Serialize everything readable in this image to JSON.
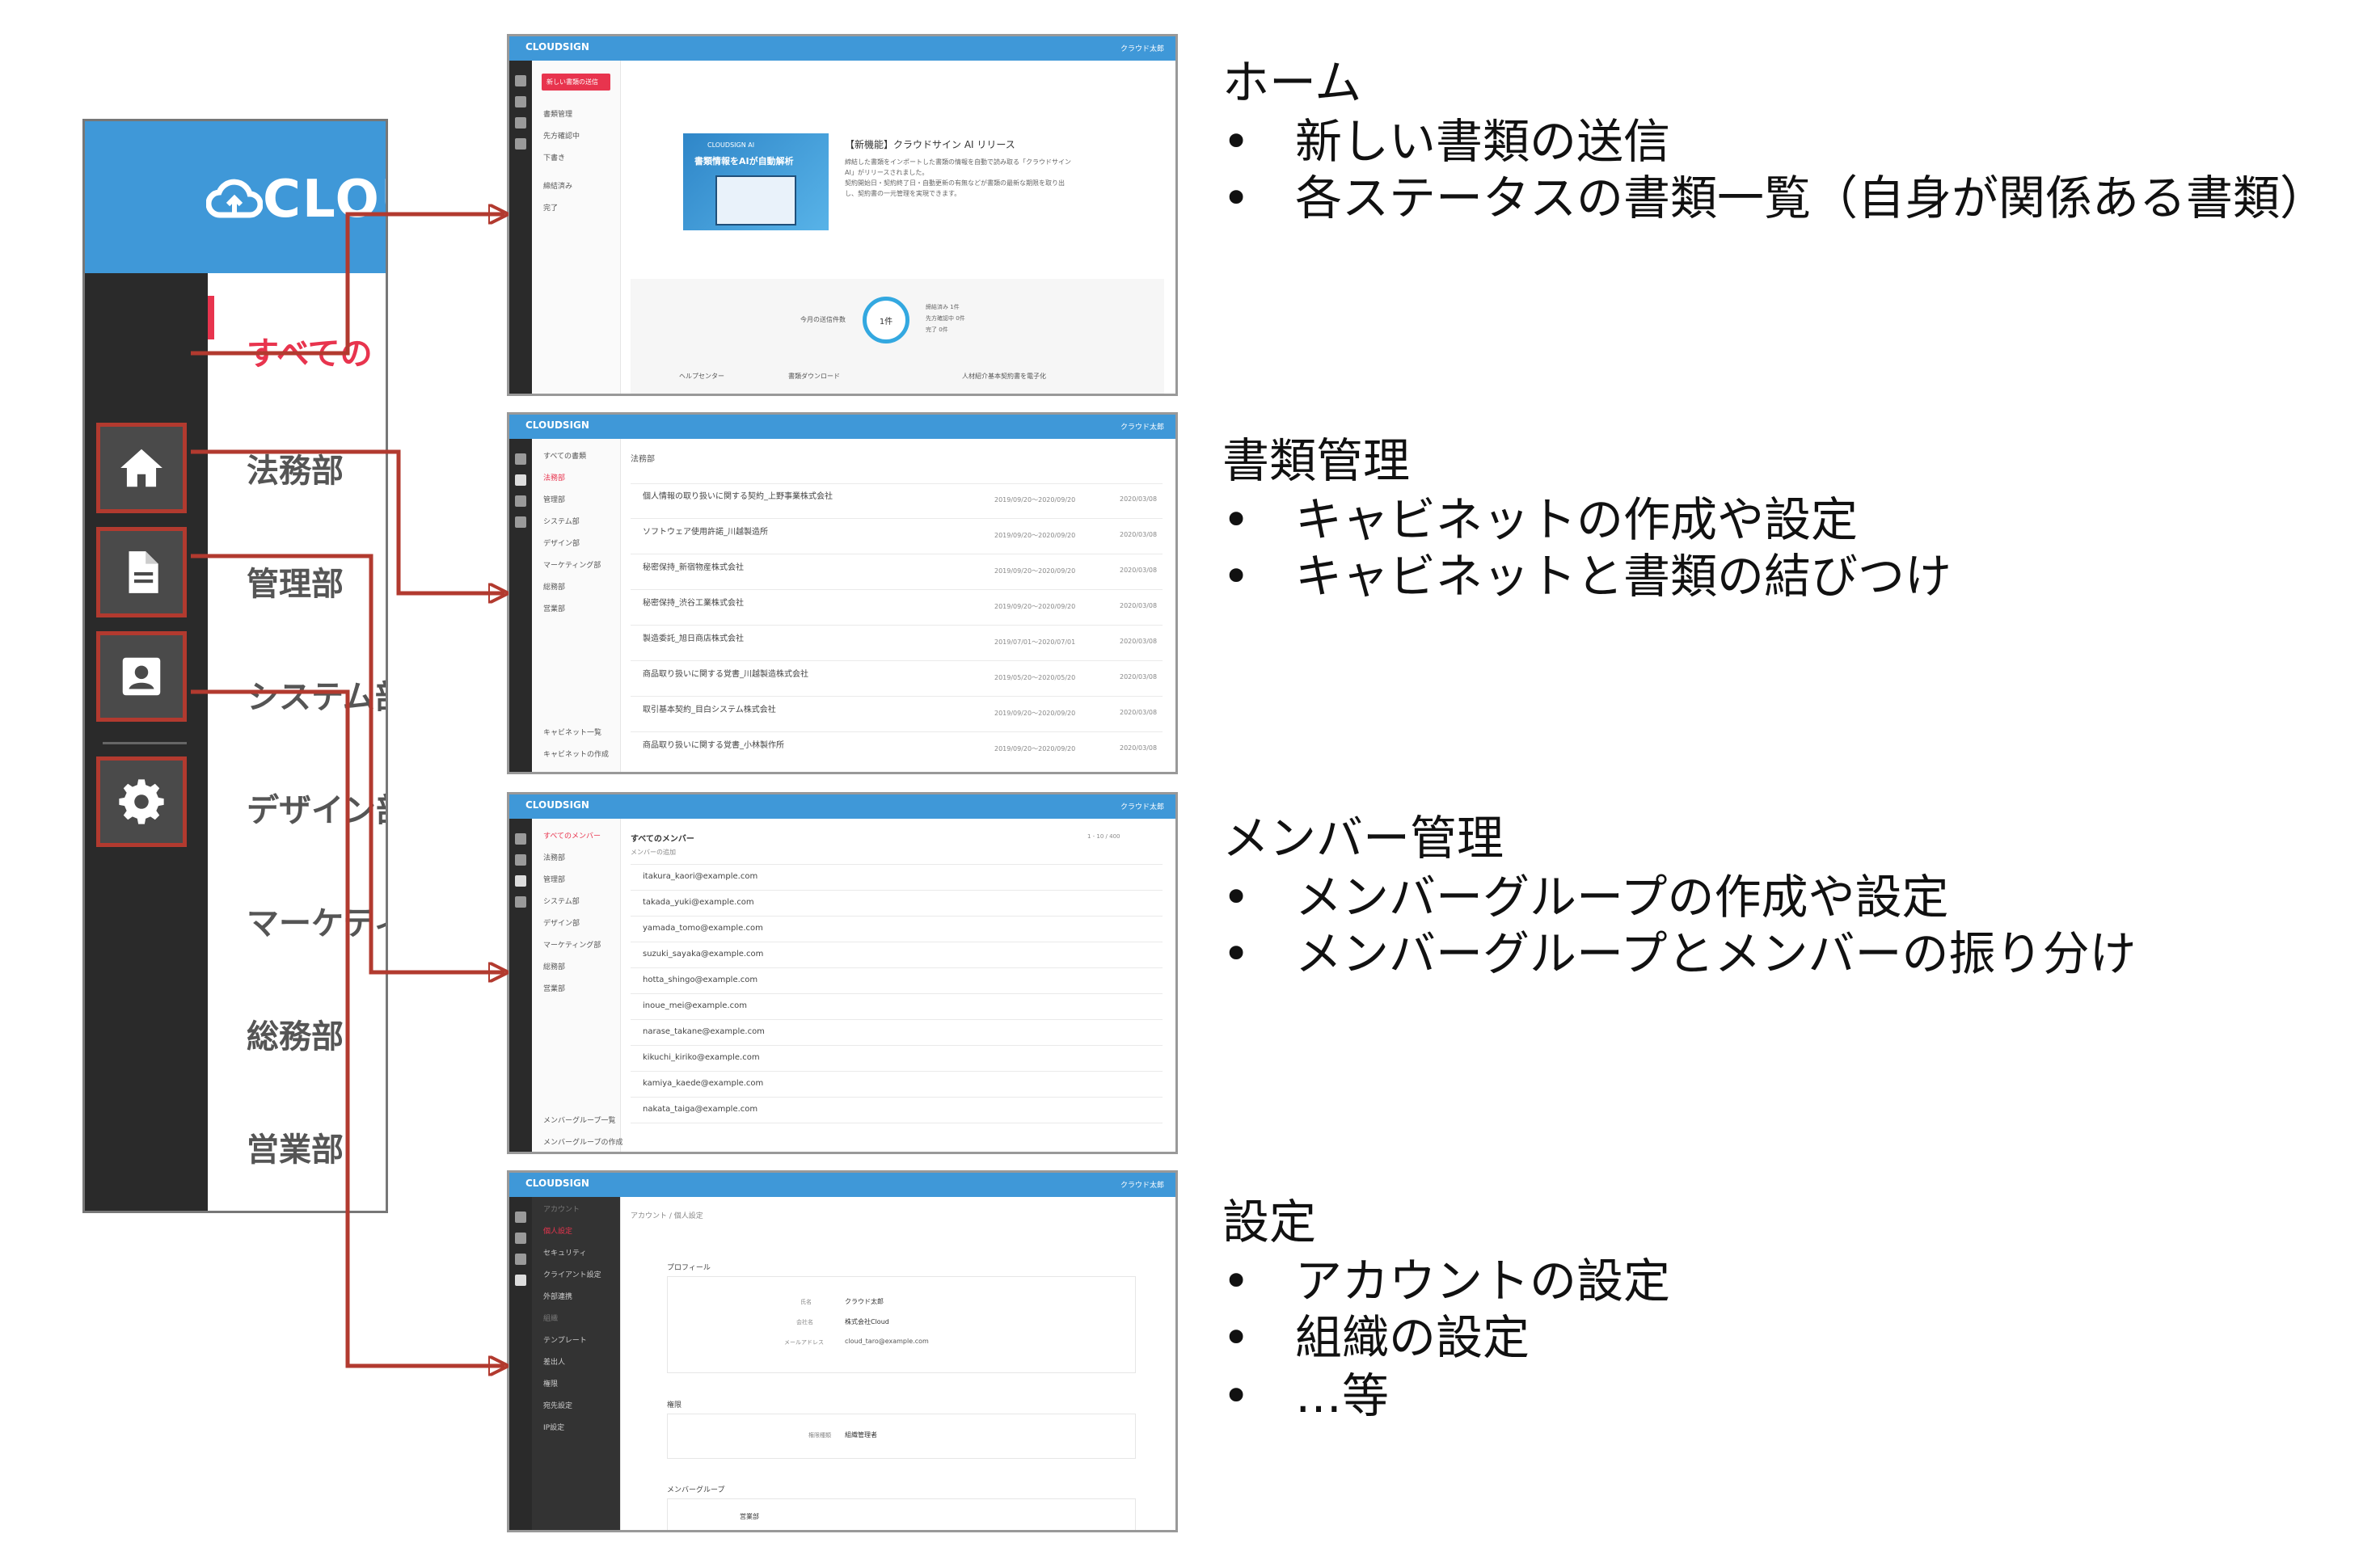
{
  "left_panel": {
    "logo": "CLOU",
    "active_text": "すべての",
    "items": [
      "法務部",
      "管理部",
      "システム部",
      "デザイン部",
      "マーケティ",
      "総務部",
      "営業部"
    ],
    "buttons": [
      "home-icon",
      "document-icon",
      "member-icon",
      "gear-icon"
    ]
  },
  "thumb_common": {
    "logo": "CLOUDSIGN",
    "top_right": "クラウド太郎"
  },
  "thumb_home": {
    "new_button": "新しい書類の送信",
    "menu": [
      "書類管理",
      "先方確認中",
      "下書き",
      "締結済み",
      "完了"
    ],
    "banner_line1": "CLOUDSIGN AI",
    "banner_line2": "書類情報をAIが自動解析",
    "news_title": "【新機能】クラウドサイン AI リリース",
    "news_body": [
      "締結した書類をインポートした書類の情報を自動で読み取る「クラウドサイン",
      "AI」がリリースされました。",
      "契約開始日・契約終了日・自動更新の有無などが書類の最新な期限を取り出",
      "し、契約書の一元管理を実現できます。"
    ],
    "donut_label": "今月の送信件数",
    "donut_value": "1件",
    "legend": [
      "締結済み 1件",
      "先方確認中 0件",
      "完了 0件"
    ],
    "footer": [
      "ヘルプセンター",
      "書類ダウンロード",
      "人材紹介基本契約書を電子化"
    ]
  },
  "thumb_docs": {
    "header": "法務部",
    "menu": [
      "すべての書類",
      "法務部",
      "管理部",
      "システム部",
      "デザイン部",
      "マーケティング部",
      "総務部",
      "営業部",
      "キャビネット一覧",
      "キャビネットの作成"
    ],
    "rows": [
      "個人情報の取り扱いに関する契約_上野事業株式会社",
      "ソフトウェア使用許諾_川越製造所",
      "秘密保持_新宿物産株式会社",
      "秘密保持_渋谷工業株式会社",
      "製造委託_旭日商店株式会社",
      "商品取り扱いに関する覚書_川越製造株式会社",
      "取引基本契約_目白システム株式会社",
      "商品取り扱いに関する覚書_小林製作所"
    ],
    "dates": [
      "2019/09/20〜2020/09/20",
      "2019/09/20〜2020/09/20",
      "2019/09/20〜2020/09/20",
      "2019/09/20〜2020/09/20",
      "2019/07/01〜2020/07/01",
      "2019/05/20〜2020/05/20",
      "2019/09/20〜2020/09/20",
      "2019/09/20〜2020/09/20"
    ],
    "updated": "2020/03/08"
  },
  "thumb_members": {
    "header": "すべてのメンバー",
    "add": "メンバーの追加",
    "menu": [
      "すべてのメンバー",
      "法務部",
      "管理部",
      "システム部",
      "デザイン部",
      "マーケティング部",
      "総務部",
      "営業部",
      "メンバーグループ一覧",
      "メンバーグループの作成"
    ],
    "emails": [
      "itakura_kaori@example.com",
      "takada_yuki@example.com",
      "yamada_tomo@example.com",
      "suzuki_sayaka@example.com",
      "hotta_shingo@example.com",
      "inoue_mei@example.com",
      "narase_takane@example.com",
      "kikuchi_kiriko@example.com",
      "kamiya_kaede@example.com",
      "nakata_taiga@example.com"
    ],
    "pager": "1 - 10 / 400"
  },
  "thumb_settings": {
    "header": "アカウント / 個人設定",
    "menu": [
      "アカウント",
      "個人設定",
      "セキュリティ",
      "クライアント設定",
      "外部連携",
      "組織",
      "テンプレート",
      "差出人",
      "権限",
      "宛先設定",
      "IP設定"
    ],
    "profile_label": "プロフィール",
    "name_label": "氏名",
    "name_value": "クラウド太郎",
    "company_label": "会社名",
    "company_value": "株式会社Cloud",
    "email_label": "メールアドレス",
    "email_value": "cloud_taro@example.com",
    "role_label": "権限",
    "role_key": "権限種類",
    "role_value": "組織管理者",
    "group_label": "メンバーグループ",
    "group_value": "営業部"
  },
  "sections": [
    {
      "title": "ホーム",
      "bullets": [
        "新しい書類の送信",
        "各ステータスの書類一覧（自身が関係ある書類）"
      ]
    },
    {
      "title": "書類管理",
      "bullets": [
        "キャビネットの作成や設定",
        "キャビネットと書類の結びつけ"
      ]
    },
    {
      "title": "メンバー管理",
      "bullets": [
        "メンバーグループの作成や設定",
        "メンバーグループとメンバーの振り分け"
      ]
    },
    {
      "title": "設定",
      "bullets": [
        "アカウントの設定",
        "組織の設定",
        "…等"
      ]
    }
  ],
  "bullet_char": "•",
  "colors": {
    "header_blue": "#3f98d8",
    "dark_sidebar": "#2a2a2a",
    "arrow": "#b23a2f",
    "accent_red": "#e8344e"
  }
}
